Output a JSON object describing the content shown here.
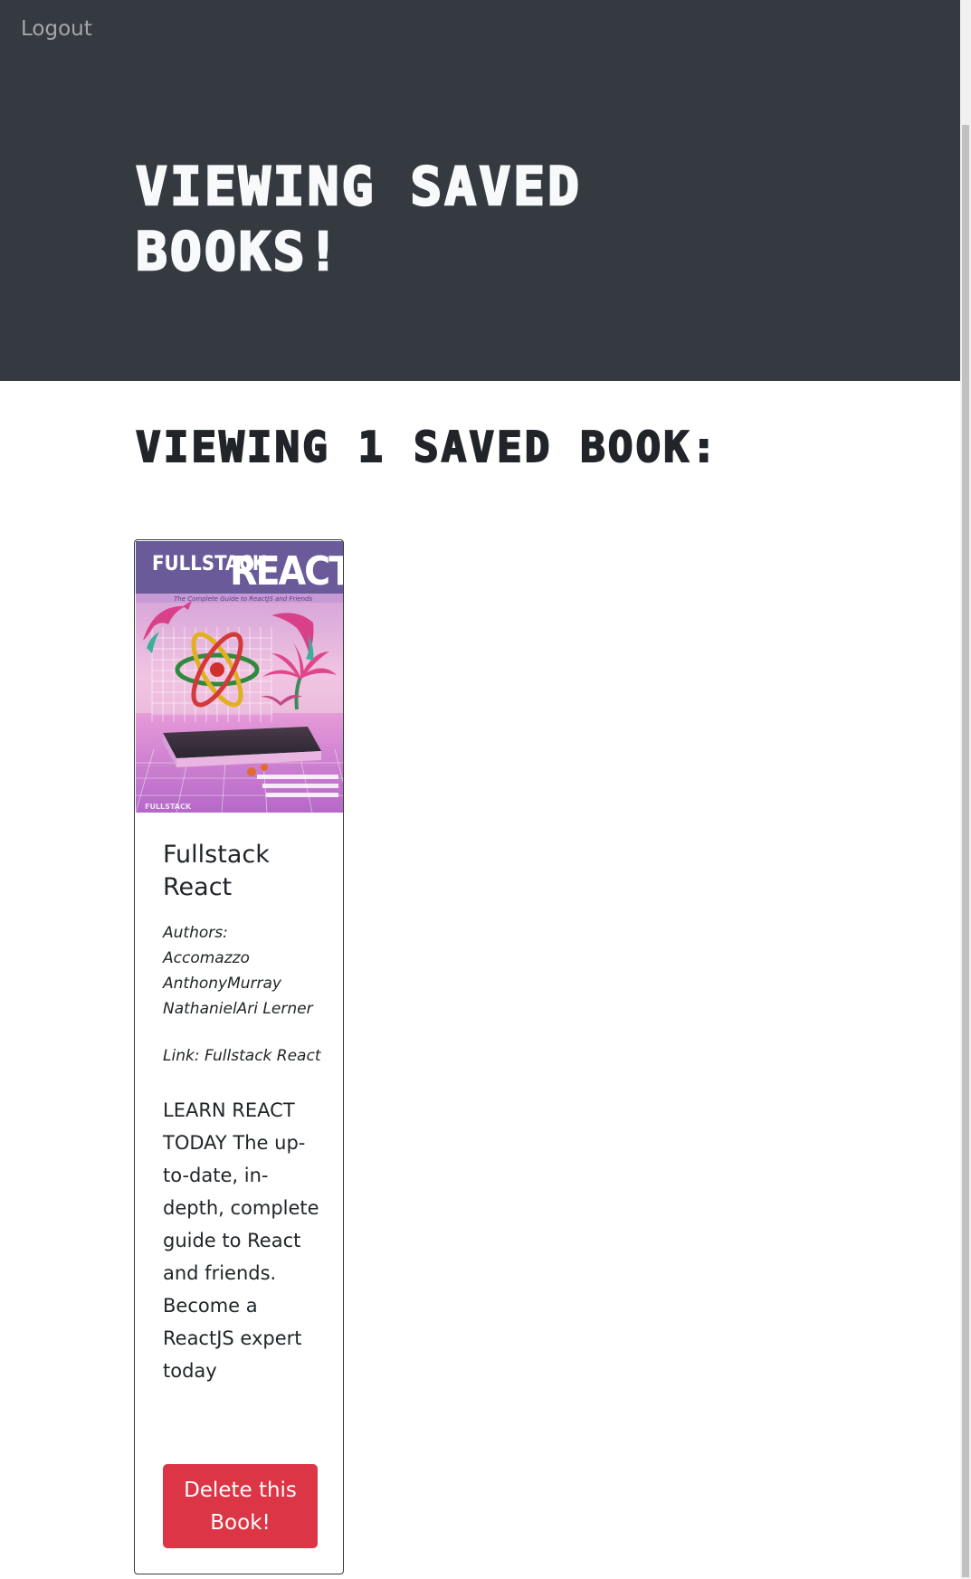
{
  "navbar": {
    "logout_label": "Logout"
  },
  "jumbotron": {
    "title": "Viewing saved books!"
  },
  "saved_books": {
    "heading": "Viewing 1 saved book:"
  },
  "book": {
    "title": "Fullstack React",
    "authors_label": "Authors:",
    "authors": [
      "Accomazzo",
      "AnthonyMurray",
      "NathanielAri Lerner"
    ],
    "link": "Link: Fullstack React",
    "description": "LEARN REACT TODAY The up-to-date, in-depth, complete guide to React and friends. Become a ReactJS expert today",
    "delete_label": "Delete this Book!",
    "cover": {
      "name_text": "FULLSTACK",
      "title_text": "REACT",
      "subtitle_text": "The Complete Guide to ReactJS and Friends",
      "brand_text": "FULLSTACK"
    }
  },
  "colors": {
    "dark_bg": "#343a40",
    "danger": "#dc3545",
    "text": "#212529",
    "light_text": "#f8f9fa"
  }
}
